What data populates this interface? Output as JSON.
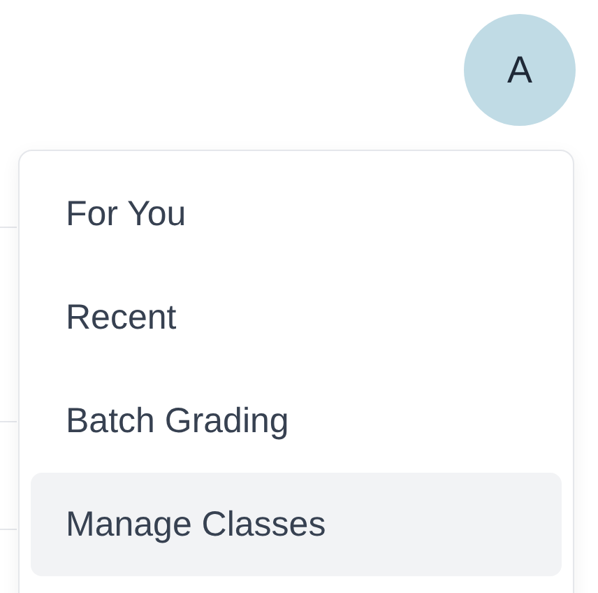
{
  "avatar": {
    "initial": "A"
  },
  "menu": {
    "items": [
      {
        "label": "For You",
        "selected": false
      },
      {
        "label": "Recent",
        "selected": false
      },
      {
        "label": "Batch Grading",
        "selected": false
      },
      {
        "label": "Manage Classes",
        "selected": true
      }
    ]
  }
}
